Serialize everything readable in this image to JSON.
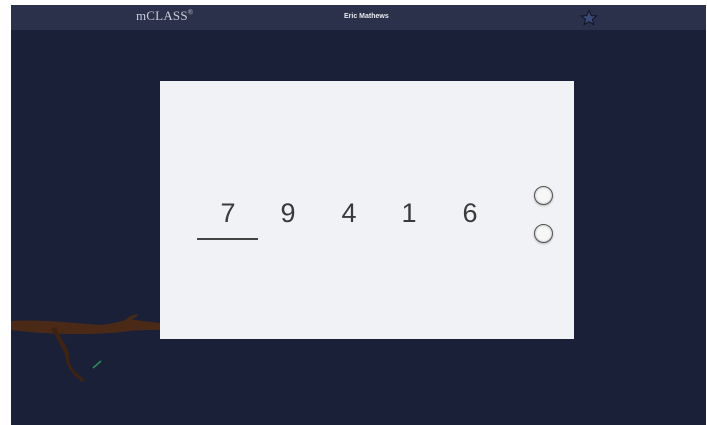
{
  "header": {
    "logo": "mCLASS",
    "logo_mark": "®",
    "user_name": "Eric Mathews",
    "star_icon": "star-icon"
  },
  "card": {
    "digits": [
      "7",
      "9",
      "4",
      "1",
      "6"
    ],
    "underlined_index": 0,
    "options": [
      "option-1",
      "option-2"
    ]
  },
  "colors": {
    "background": "#1b2039",
    "header": "#2b314a",
    "card": "#f1f2f5",
    "owl": "#a58fc9",
    "branch": "#4a2a16"
  }
}
